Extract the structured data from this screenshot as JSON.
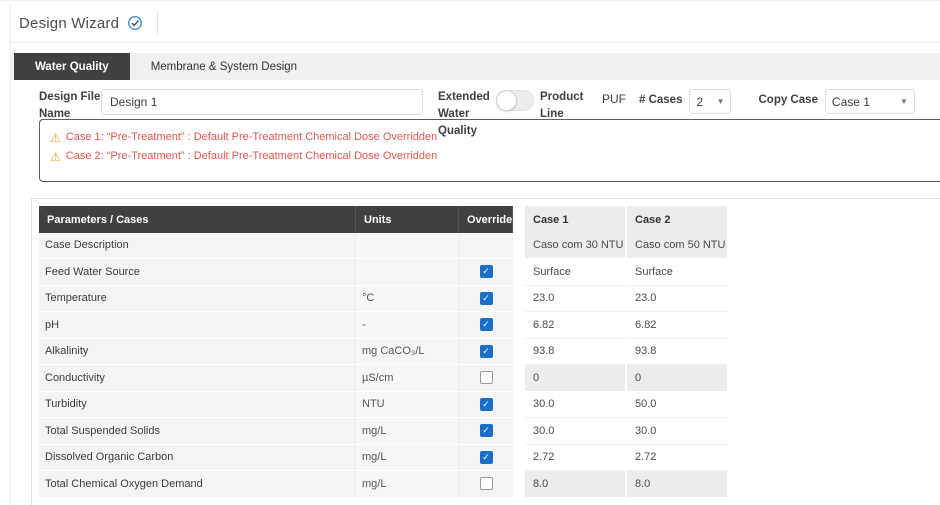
{
  "title": {
    "text": "Design Wizard"
  },
  "tabs": [
    {
      "label": "Water Quality",
      "active": true
    },
    {
      "label": "Membrane & System Design",
      "active": false
    }
  ],
  "toolbar": {
    "design_file_label": "Design File Name",
    "design_file_value": "Design 1",
    "extended_label": "Extended Water Quality",
    "extended_toggle_state": "off",
    "product_line_label": "Product Line",
    "product_line_value": "PUF",
    "cases_label": "# Cases",
    "cases_value": "2",
    "copy_case_label": "Copy Case",
    "copy_case_value": "Case 1"
  },
  "warnings": [
    "Case 1: “Pre-Treatment” : Default Pre-Treatment Chemical Dose Overridden",
    "Case 2: “Pre-Treatment” : Default Pre-Treatment Chemical Dose Overridden"
  ],
  "table": {
    "headers": {
      "params": "Parameters / Cases",
      "units": "Units",
      "override": "Override"
    },
    "case_headers": [
      "Case 1",
      "Case 2"
    ],
    "rows": [
      {
        "param": "Case Description",
        "units": "",
        "override": null,
        "values": [
          "Caso com 30 NTU",
          "Caso com 50 NTU"
        ]
      },
      {
        "param": "Feed Water Source",
        "units": "",
        "override": true,
        "values": [
          "Surface",
          "Surface"
        ]
      },
      {
        "param": "Temperature",
        "units": "°C",
        "override": true,
        "values": [
          "23.0",
          "23.0"
        ]
      },
      {
        "param": "pH",
        "units": "-",
        "override": true,
        "values": [
          "6.82",
          "6.82"
        ]
      },
      {
        "param": "Alkalinity",
        "units": "mg CaCO₃/L",
        "override": true,
        "values": [
          "93.8",
          "93.8"
        ]
      },
      {
        "param": "Conductivity",
        "units": "µS/cm",
        "override": false,
        "values": [
          "0",
          "0"
        ]
      },
      {
        "param": "Turbidity",
        "units": "NTU",
        "override": true,
        "values": [
          "30.0",
          "50.0"
        ]
      },
      {
        "param": "Total Suspended Solids",
        "units": "mg/L",
        "override": true,
        "values": [
          "30.0",
          "30.0"
        ]
      },
      {
        "param": "Dissolved Organic Carbon",
        "units": "mg/L",
        "override": true,
        "values": [
          "2.72",
          "2.72"
        ]
      },
      {
        "param": "Total Chemical Oxygen Demand",
        "units": "mg/L",
        "override": false,
        "values": [
          "8.0",
          "8.0"
        ]
      }
    ]
  },
  "colors": {
    "header_dark": "#414141",
    "accent_blue": "#1b6fc9",
    "warning_text": "#e2574c",
    "warning_icon": "#f0a12e"
  }
}
